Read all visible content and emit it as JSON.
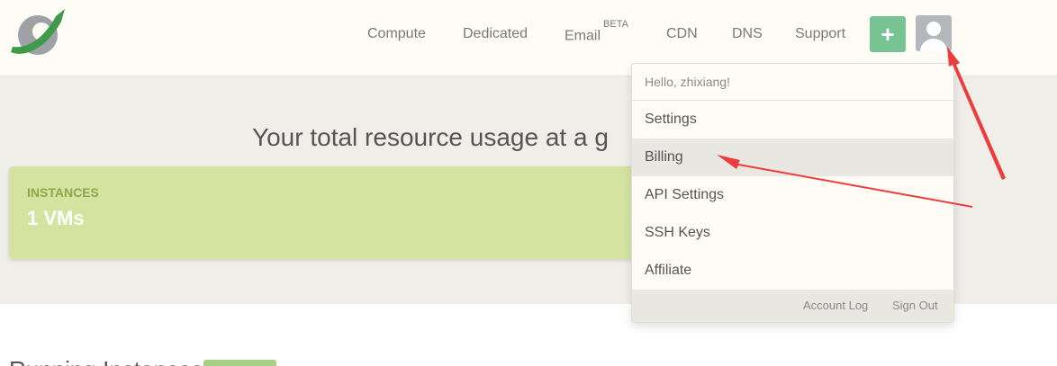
{
  "nav": {
    "items": [
      {
        "label": "Compute"
      },
      {
        "label": "Dedicated"
      },
      {
        "label": "Email",
        "badge": "BETA"
      },
      {
        "label": "CDN"
      },
      {
        "label": "DNS"
      },
      {
        "label": "Support"
      }
    ],
    "add_label": "+"
  },
  "hero": {
    "title": "Your total resource usage at a g"
  },
  "instances_card": {
    "label": "INSTANCES",
    "value": "1 VMs"
  },
  "running": {
    "title": "Running Instances"
  },
  "dropdown": {
    "greeting": "Hello, zhixiang!",
    "items": [
      {
        "label": "Settings"
      },
      {
        "label": "Billing"
      },
      {
        "label": "API Settings"
      },
      {
        "label": "SSH Keys"
      },
      {
        "label": "Affiliate"
      }
    ],
    "footer": {
      "account_log": "Account Log",
      "sign_out": "Sign Out"
    }
  },
  "colors": {
    "accent_green": "#77c393",
    "card_green": "#d4e4a0",
    "arrow_red": "#ee3b3b"
  },
  "icons": {
    "logo": "orbit-logo-icon",
    "avatar": "user-silhouette-icon"
  }
}
